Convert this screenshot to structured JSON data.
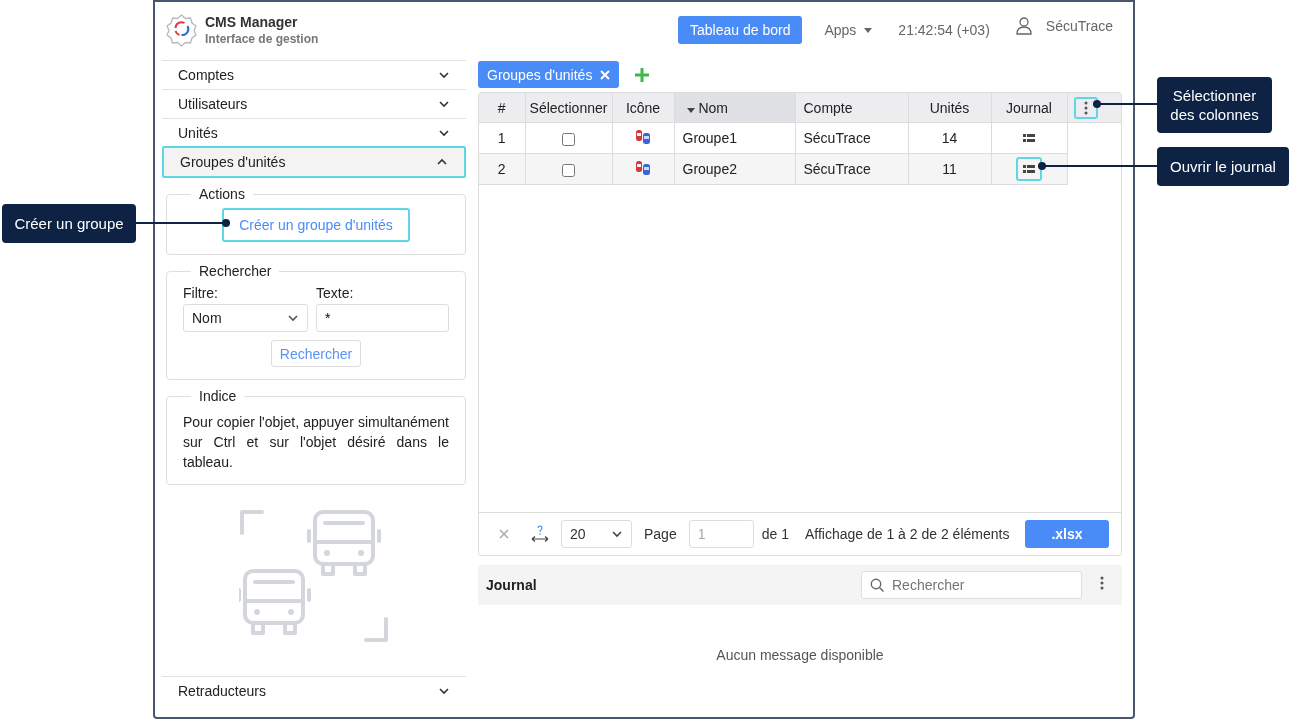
{
  "header": {
    "app_title": "CMS Manager",
    "app_subtitle": "Interface de gestion",
    "dashboard_button": "Tableau de bord",
    "apps_menu": "Apps",
    "clock": "21:42:54 (+03)",
    "user": "SécuTrace"
  },
  "sidebar": {
    "sections": [
      {
        "label": "Comptes",
        "expanded": false
      },
      {
        "label": "Utilisateurs",
        "expanded": false
      },
      {
        "label": "Unités",
        "expanded": false
      },
      {
        "label": "Groupes d'unités",
        "expanded": true
      }
    ],
    "actions": {
      "legend": "Actions",
      "create_button": "Créer un groupe d'unités",
      "create_highlighted": true
    },
    "search": {
      "legend": "Rechercher",
      "filter_label": "Filtre:",
      "filter_value": "Nom",
      "text_label": "Texte:",
      "text_value": "*",
      "button": "Rechercher"
    },
    "hint": {
      "legend": "Indice",
      "text": "Pour copier l'objet, appuyer simultanément sur Ctrl et sur l'objet désiré dans le tableau."
    },
    "bottom_sections": [
      {
        "label": "Retraducteurs",
        "expanded": false
      }
    ]
  },
  "tabs": [
    {
      "label": "Groupes d'unités",
      "selected": true
    }
  ],
  "table": {
    "columns": [
      {
        "label": "#",
        "sorted": false
      },
      {
        "label": "Sélectionner",
        "sorted": false
      },
      {
        "label": "Icône",
        "sorted": false
      },
      {
        "label": "Nom",
        "sorted": true
      },
      {
        "label": "Compte",
        "sorted": false
      },
      {
        "label": "Unités",
        "sorted": false
      },
      {
        "label": "Journal",
        "sorted": false
      }
    ],
    "column_menu_highlighted": true,
    "rows": [
      {
        "number": "1",
        "checked": false,
        "name": "Groupe1",
        "account": "SécuTrace",
        "units": "14",
        "journal_highlighted": false
      },
      {
        "number": "2",
        "checked": false,
        "name": "Groupe2",
        "account": "SécuTrace",
        "units": "11",
        "journal_highlighted": true
      }
    ]
  },
  "pager": {
    "page_size": "20",
    "page_label": "Page",
    "page_value": "1",
    "of_pages": "de 1",
    "summary": "Affichage de 1 à 2 de 2 éléments",
    "export_button": ".xlsx"
  },
  "journal": {
    "title": "Journal",
    "search_placeholder": "Rechercher",
    "empty_message": "Aucun message disponible"
  },
  "callouts": [
    {
      "text": "Créer un groupe"
    },
    {
      "text": "Sélectionner des colonnes"
    },
    {
      "text": "Ouvrir le journal"
    }
  ]
}
